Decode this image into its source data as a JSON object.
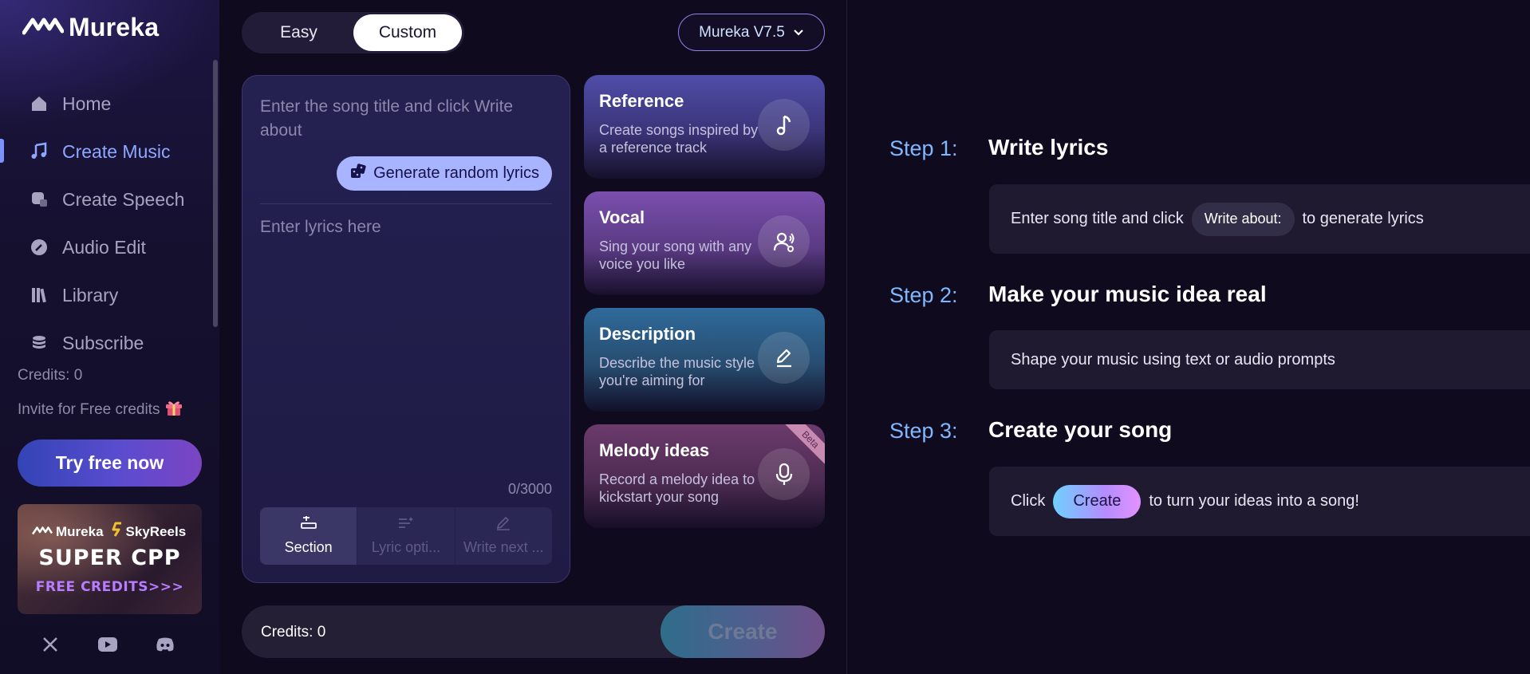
{
  "app": {
    "logo_text": "Mureka"
  },
  "sidebar": {
    "nav": [
      {
        "label": "Home",
        "icon": "home-icon",
        "active": false
      },
      {
        "label": "Create Music",
        "icon": "music-note-icon",
        "active": true
      },
      {
        "label": "Create Speech",
        "icon": "speech-icon",
        "active": false
      },
      {
        "label": "Audio Edit",
        "icon": "edit-icon",
        "active": false
      },
      {
        "label": "Library",
        "icon": "library-icon",
        "active": false
      },
      {
        "label": "Subscribe",
        "icon": "coins-icon",
        "active": false
      }
    ],
    "credits": "Credits: 0",
    "invite": "Invite for Free credits",
    "try_button": "Try free now",
    "promo": {
      "brand1": "Mureka",
      "brand2": "SkyReels",
      "headline": "SUPER CPP",
      "subline": "FREE CREDITS>>>"
    },
    "socials": [
      "x-icon",
      "youtube-icon",
      "discord-icon"
    ]
  },
  "mode": {
    "easy": "Easy",
    "custom": "Custom",
    "selected": "Custom"
  },
  "model": {
    "selected": "Mureka V7.5"
  },
  "lyrics": {
    "title_placeholder": "Enter the song title and click Write about",
    "generate_button": "Generate random lyrics",
    "lyrics_placeholder": "Enter lyrics here",
    "counter": "0/3000",
    "tools": [
      {
        "label": "Section",
        "active": true
      },
      {
        "label": "Lyric opti...",
        "active": false
      },
      {
        "label": "Write next ...",
        "active": false
      }
    ]
  },
  "features": [
    {
      "title": "Reference",
      "desc": "Create songs inspired by a reference track",
      "icon": "music-note-icon"
    },
    {
      "title": "Vocal",
      "desc": "Sing your song with any voice you like",
      "icon": "voice-user-icon"
    },
    {
      "title": "Description",
      "desc": "Describe the music style you're aiming for",
      "icon": "pen-icon"
    },
    {
      "title": "Melody ideas",
      "desc": "Record a melody idea to kickstart your song",
      "icon": "microphone-icon",
      "badge": "Beta"
    }
  ],
  "bottom": {
    "credits": "Credits: 0",
    "create_button": "Create"
  },
  "steps": [
    {
      "label": "Step 1:",
      "title": "Write lyrics",
      "pre": "Enter song title and click",
      "chip": "Write about:",
      "post": "to generate lyrics"
    },
    {
      "label": "Step 2:",
      "title": "Make your music idea real",
      "text": "Shape your music using text or audio prompts"
    },
    {
      "label": "Step 3:",
      "title": "Create your song",
      "pre": "Click",
      "chip": "Create",
      "post": "to turn your ideas into a song!"
    }
  ],
  "colors": {
    "background": "#100a1e",
    "accent_blue": "#8fa8ff",
    "step_label": "#7fb8ff",
    "generate_button": "#a8b4ff"
  }
}
